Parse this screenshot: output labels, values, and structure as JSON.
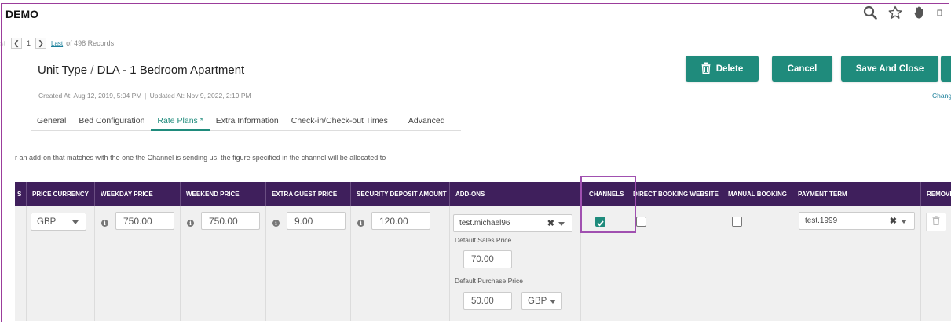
{
  "app": {
    "title": "DEMO"
  },
  "pager": {
    "current": "1",
    "last_label": "Last",
    "records": "of 498 Records"
  },
  "header": {
    "breadcrumb_parent": "Unit Type",
    "breadcrumb_sep": " / ",
    "breadcrumb_current": "DLA - 1 Bedroom Apartment",
    "created": "Created At: Aug 12, 2019, 5:04 PM",
    "updated": "Updated At: Nov 9, 2022, 2:19 PM"
  },
  "actions": {
    "delete_label": "Delete",
    "cancel_label": "Cancel",
    "save_label": "Save And Close",
    "change_link": "Chang"
  },
  "tabs": [
    {
      "label": "General"
    },
    {
      "label": "Bed Configuration"
    },
    {
      "label": "Rate Plans *",
      "active": true
    },
    {
      "label": "Extra Information"
    },
    {
      "label": "Check-in/Check-out Times"
    },
    {
      "label": "Advanced"
    }
  ],
  "note": "r an add-on that matches with the one the Channel is sending us, the figure specified in the channel will be allocated to",
  "table": {
    "headers": {
      "s": "S",
      "currency": "PRICE CURRENCY",
      "weekday": "WEEKDAY PRICE",
      "weekend": "WEEKEND PRICE",
      "extra_guest": "EXTRA GUEST PRICE",
      "security": "SECURITY DEPOSIT AMOUNT",
      "addons": "ADD-ONS",
      "channels": "CHANNELS",
      "direct": "DIRECT BOOKING WEBSITE",
      "manual": "MANUAL BOOKING",
      "payment": "PAYMENT TERM",
      "remove": "REMOVE"
    },
    "row": {
      "currency": "GBP",
      "weekday_price": "750.00",
      "weekend_price": "750.00",
      "extra_guest_price": "9.00",
      "security_deposit": "120.00",
      "addon_name": "test.michael96",
      "default_sales_label": "Default Sales Price",
      "default_sales_price": "70.00",
      "default_purchase_label": "Default Purchase Price",
      "default_purchase_price": "50.00",
      "purchase_currency": "GBP",
      "channels_checked": true,
      "direct_booking_checked": false,
      "manual_booking_checked": false,
      "payment_term": "test.1999"
    }
  },
  "colors": {
    "accent": "#1f8b7c",
    "header_bg": "#3f1f5c",
    "highlight": "#a050b0"
  },
  "icons": [
    "search-icon",
    "star-icon",
    "hand-icon",
    "chevron-left-icon",
    "chevron-right-icon",
    "info-icon",
    "trash-icon",
    "check-icon",
    "close-icon",
    "caret-down-icon"
  ]
}
